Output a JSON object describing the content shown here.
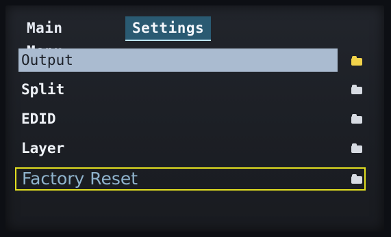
{
  "tabs": [
    {
      "label": "Main Menu",
      "active": false
    },
    {
      "label": "Settings",
      "active": true
    }
  ],
  "menu": {
    "items": [
      {
        "label": "Output",
        "selected": true,
        "icon": "folder-open-icon"
      },
      {
        "label": "Split",
        "selected": false,
        "icon": "folder-icon"
      },
      {
        "label": "EDID",
        "selected": false,
        "icon": "folder-icon"
      },
      {
        "label": "Layer",
        "selected": false,
        "icon": "folder-icon"
      },
      {
        "label": "Factory Reset",
        "selected": false,
        "focused": true,
        "icon": "folder-icon"
      }
    ]
  },
  "colors": {
    "selected_row": "#aabbd0",
    "focus_outline": "#e3e020",
    "active_tab": "#2a5a72",
    "open_folder": "#f1d24a"
  }
}
